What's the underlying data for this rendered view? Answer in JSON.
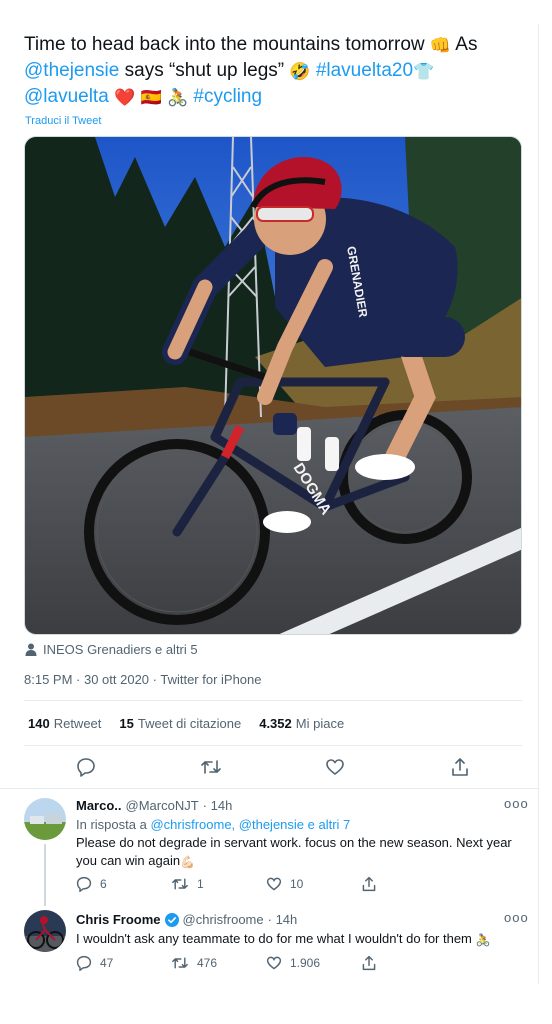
{
  "tweet": {
    "text_1": "Time to head back into the mountains tomorrow",
    "emoji_fist": "👊",
    "text_2": "As",
    "mention_jensie": "@thejensie",
    "text_3": "says “shut up legs”",
    "emoji_laugh": "🤣",
    "hashtag_lavuelta": "#lavuelta20",
    "emoji_jersey": "👕",
    "mention_lavuelta": "@lavuelta",
    "emoji_heart": "❤️",
    "emoji_flag": "🇪🇸",
    "emoji_cyclist": "🚴",
    "hashtag_cycling": "#cycling",
    "translate_label": "Traduci il Tweet",
    "tagged": "INEOS Grenadiers e altri 5",
    "time": "8:15 PM · 30 ott 2020 · Twitter for iPhone",
    "stats": {
      "retweets_count": "140",
      "retweets_label": "Retweet",
      "quotes_count": "15",
      "quotes_label": "Tweet di citazione",
      "likes_count": "4.352",
      "likes_label": "Mi piace"
    }
  },
  "photo": {
    "jersey_text": "GRENADIER",
    "bike_text": "DOGMA"
  },
  "replies": [
    {
      "name": "Marco..",
      "handle": "@MarcoNJT",
      "time": "· 14h",
      "reply_to_prefix": "In risposta a",
      "reply_to_mentions": "@chrisfroome, @thejensie e altri 7",
      "text": "Please do not degrade in servant work. focus on the new season. Next year you can win again",
      "emoji": "💪🏻",
      "replies": "6",
      "retweets": "1",
      "likes": "10"
    },
    {
      "name": "Chris Froome",
      "handle": "@chrisfroome",
      "time": "· 14h",
      "text": "I wouldn't ask any teammate to do for me what I wouldn't do for them",
      "emoji": "🚴",
      "replies": "47",
      "retweets": "476",
      "likes": "1.906"
    }
  ],
  "more_label": "ooo",
  "colors": {
    "link": "#1d9bf0",
    "muted": "#536471",
    "text": "#0f1419",
    "divider": "#e6ecf0"
  },
  "icons": [
    "reply-icon",
    "retweet-icon",
    "like-icon",
    "share-icon",
    "person-icon",
    "verified-icon"
  ]
}
